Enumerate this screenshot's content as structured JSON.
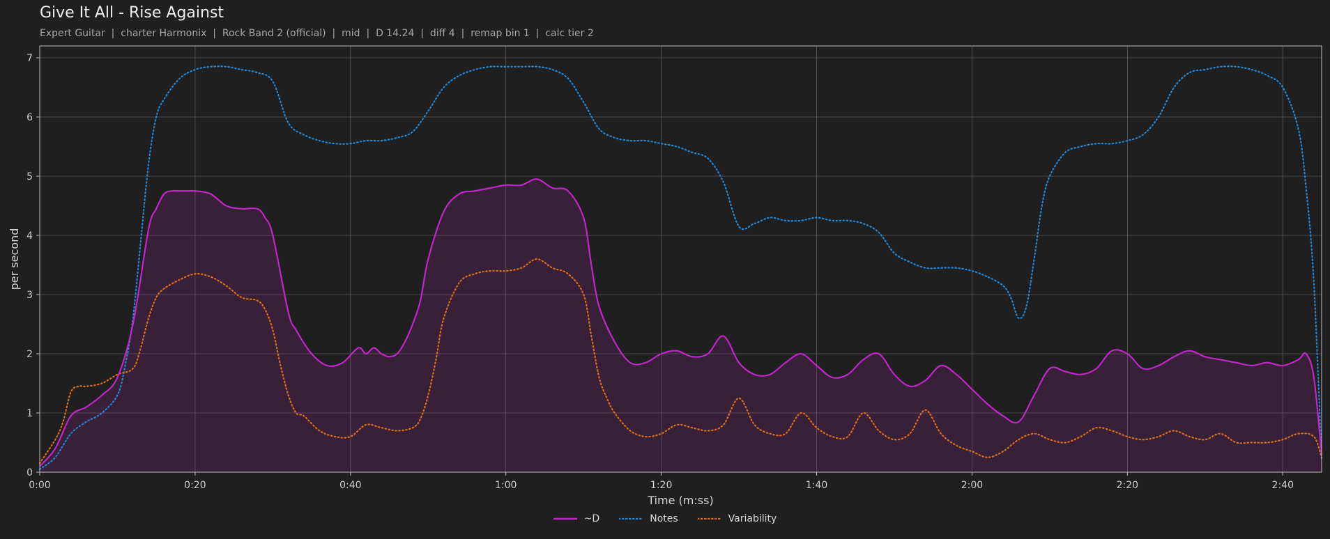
{
  "chart_data": {
    "type": "line",
    "title": "Give It All - Rise Against",
    "subtitle": "Expert Guitar  |  charter Harmonix  |  Rock Band 2 (official)  |  mid  |  D 14.24  |  diff 4  |  remap bin 1  |  calc tier 2",
    "xlabel": "Time (m:ss)",
    "ylabel": "per second",
    "xlim": [
      0,
      165
    ],
    "ylim": [
      0,
      7.2
    ],
    "x_ticks": [
      0,
      20,
      40,
      60,
      80,
      100,
      120,
      140,
      160
    ],
    "x_tick_labels": [
      "0:00",
      "0:20",
      "0:40",
      "1:00",
      "1:20",
      "1:40",
      "2:00",
      "2:20",
      "2:40"
    ],
    "y_ticks": [
      0,
      1,
      2,
      3,
      4,
      5,
      6,
      7
    ],
    "y_tick_labels": [
      "0",
      "1",
      "2",
      "3",
      "4",
      "5",
      "6",
      "7"
    ],
    "grid": true,
    "legend_position": "bottom-center",
    "series": [
      {
        "name": "~D",
        "color": "#c026c8",
        "style": "solid",
        "fill": true,
        "x": [
          0,
          2,
          4,
          6,
          8,
          10,
          12,
          14,
          15,
          16,
          17,
          18,
          19,
          20,
          22,
          24,
          26,
          28,
          29,
          30,
          32,
          33,
          35,
          37,
          39,
          41,
          42,
          43,
          44,
          45,
          46,
          47,
          48,
          49,
          50,
          52,
          54,
          56,
          58,
          60,
          62,
          64,
          66,
          68,
          70,
          71,
          72,
          74,
          76,
          78,
          80,
          82,
          84,
          86,
          88,
          90,
          92,
          94,
          96,
          98,
          100,
          102,
          104,
          106,
          108,
          110,
          112,
          114,
          116,
          118,
          120,
          122,
          124,
          126,
          128,
          130,
          132,
          134,
          136,
          138,
          140,
          142,
          144,
          146,
          148,
          150,
          152,
          154,
          156,
          158,
          160,
          162,
          163,
          164,
          165
        ],
        "y": [
          0.1,
          0.4,
          0.95,
          1.1,
          1.3,
          1.6,
          2.5,
          4.1,
          4.45,
          4.7,
          4.75,
          4.75,
          4.75,
          4.75,
          4.7,
          4.5,
          4.45,
          4.45,
          4.3,
          4.0,
          2.7,
          2.4,
          2.0,
          1.8,
          1.85,
          2.1,
          2.0,
          2.1,
          2.0,
          1.95,
          2.0,
          2.2,
          2.5,
          2.9,
          3.6,
          4.4,
          4.7,
          4.75,
          4.8,
          4.85,
          4.85,
          4.95,
          4.8,
          4.75,
          4.3,
          3.5,
          2.8,
          2.2,
          1.85,
          1.85,
          2.0,
          2.05,
          1.95,
          2.0,
          2.3,
          1.85,
          1.65,
          1.65,
          1.85,
          2.0,
          1.8,
          1.6,
          1.65,
          1.9,
          2.0,
          1.65,
          1.45,
          1.55,
          1.8,
          1.65,
          1.4,
          1.15,
          0.95,
          0.85,
          1.3,
          1.75,
          1.7,
          1.65,
          1.75,
          2.05,
          2.0,
          1.75,
          1.8,
          1.95,
          2.05,
          1.95,
          1.9,
          1.85,
          1.8,
          1.85,
          1.8,
          1.9,
          2.0,
          1.6,
          0.3
        ]
      },
      {
        "name": "Notes",
        "color": "#1f87d6",
        "style": "dotted",
        "fill": false,
        "x": [
          0,
          2,
          4,
          6,
          8,
          10,
          11,
          12,
          13,
          14,
          15,
          16,
          18,
          20,
          22,
          24,
          26,
          28,
          30,
          32,
          34,
          36,
          38,
          40,
          42,
          44,
          46,
          48,
          50,
          52,
          54,
          56,
          58,
          60,
          62,
          64,
          66,
          68,
          70,
          72,
          74,
          76,
          78,
          80,
          82,
          84,
          86,
          88,
          90,
          92,
          94,
          96,
          98,
          100,
          102,
          104,
          106,
          108,
          110,
          112,
          114,
          116,
          118,
          120,
          122,
          124,
          125,
          126,
          127,
          128,
          129,
          130,
          132,
          134,
          136,
          138,
          140,
          142,
          144,
          146,
          148,
          150,
          152,
          154,
          156,
          158,
          160,
          162,
          163,
          164,
          165
        ],
        "y": [
          0.05,
          0.25,
          0.65,
          0.85,
          1.0,
          1.3,
          1.8,
          2.6,
          3.9,
          5.2,
          6.0,
          6.3,
          6.65,
          6.8,
          6.85,
          6.85,
          6.8,
          6.75,
          6.6,
          5.9,
          5.7,
          5.6,
          5.55,
          5.55,
          5.6,
          5.6,
          5.65,
          5.75,
          6.1,
          6.5,
          6.7,
          6.8,
          6.85,
          6.85,
          6.85,
          6.85,
          6.8,
          6.65,
          6.25,
          5.8,
          5.65,
          5.6,
          5.6,
          5.55,
          5.5,
          5.4,
          5.3,
          4.9,
          4.15,
          4.2,
          4.3,
          4.25,
          4.25,
          4.3,
          4.25,
          4.25,
          4.2,
          4.05,
          3.7,
          3.55,
          3.45,
          3.45,
          3.45,
          3.4,
          3.3,
          3.15,
          2.95,
          2.6,
          2.8,
          3.6,
          4.5,
          5.0,
          5.4,
          5.5,
          5.55,
          5.55,
          5.6,
          5.7,
          6.0,
          6.5,
          6.75,
          6.8,
          6.85,
          6.85,
          6.8,
          6.7,
          6.5,
          5.8,
          4.8,
          3.2,
          0.2
        ]
      },
      {
        "name": "Variability",
        "color": "#d96e1a",
        "style": "dotted",
        "fill": false,
        "x": [
          0,
          2,
          3,
          4,
          5,
          6,
          8,
          10,
          12,
          13,
          14,
          15,
          16,
          18,
          20,
          22,
          24,
          26,
          28,
          29,
          30,
          31,
          32,
          33,
          34,
          36,
          38,
          40,
          42,
          44,
          46,
          48,
          49,
          50,
          51,
          52,
          54,
          56,
          58,
          60,
          62,
          64,
          66,
          68,
          70,
          71,
          72,
          73,
          74,
          76,
          78,
          80,
          82,
          84,
          86,
          88,
          90,
          92,
          94,
          96,
          98,
          100,
          102,
          104,
          106,
          108,
          110,
          112,
          114,
          116,
          118,
          120,
          122,
          124,
          126,
          128,
          130,
          132,
          134,
          136,
          138,
          140,
          142,
          144,
          146,
          148,
          150,
          152,
          154,
          156,
          158,
          160,
          162,
          164,
          165
        ],
        "y": [
          0.15,
          0.55,
          0.85,
          1.35,
          1.45,
          1.45,
          1.5,
          1.65,
          1.75,
          2.1,
          2.6,
          2.95,
          3.1,
          3.25,
          3.35,
          3.3,
          3.15,
          2.95,
          2.9,
          2.75,
          2.4,
          1.8,
          1.3,
          1.0,
          0.95,
          0.7,
          0.6,
          0.6,
          0.8,
          0.75,
          0.7,
          0.75,
          0.9,
          1.3,
          1.9,
          2.6,
          3.2,
          3.35,
          3.4,
          3.4,
          3.45,
          3.6,
          3.45,
          3.35,
          3.0,
          2.3,
          1.6,
          1.25,
          1.0,
          0.7,
          0.6,
          0.65,
          0.8,
          0.75,
          0.7,
          0.8,
          1.25,
          0.8,
          0.65,
          0.65,
          1.0,
          0.75,
          0.6,
          0.6,
          1.0,
          0.7,
          0.55,
          0.65,
          1.05,
          0.65,
          0.45,
          0.35,
          0.25,
          0.35,
          0.55,
          0.65,
          0.55,
          0.5,
          0.6,
          0.75,
          0.7,
          0.6,
          0.55,
          0.6,
          0.7,
          0.6,
          0.55,
          0.65,
          0.5,
          0.5,
          0.5,
          0.55,
          0.65,
          0.6,
          0.25
        ]
      }
    ]
  },
  "colors": {
    "background": "#1f1f1f",
    "plot_background": "#1f1f1f",
    "grid": "#5a5a5a",
    "axis": "#bdbdbd",
    "fill": "#c026c8"
  }
}
